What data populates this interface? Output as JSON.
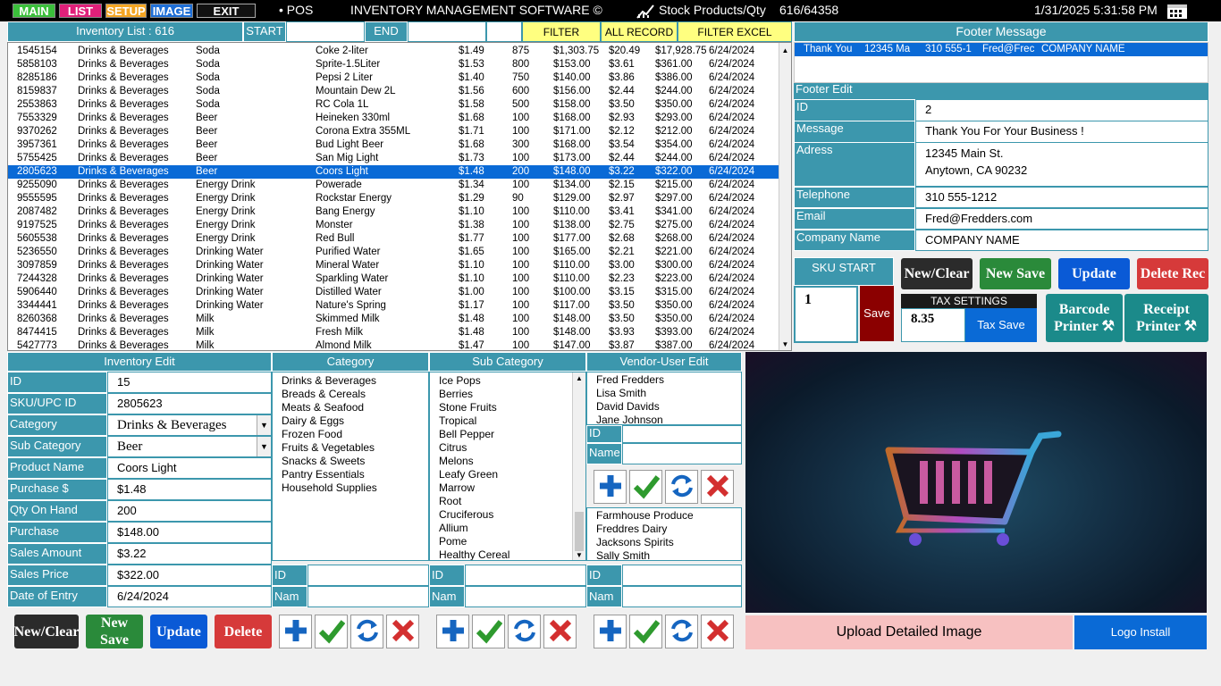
{
  "topbar": {
    "main": "MAIN",
    "list": "LIST",
    "setup": "SETUP",
    "image": "IMAGE",
    "exit": "EXIT",
    "pos": "• POS",
    "title": "INVENTORY MANAGEMENT SOFTWARE ©",
    "stock_label": "Stock Products/Qty",
    "stock_value": "616/64358",
    "datetime": "1/31/2025 5:31:58 PM"
  },
  "listbar": {
    "title": "Inventory List : 616",
    "start": "START",
    "end": "END",
    "filter": "FILTER",
    "all": "ALL RECORD",
    "excel": "FILTER EXCEL EXPORT"
  },
  "rows": [
    [
      "1545154",
      "Drinks & Beverages",
      "Soda",
      "Coke 2-liter",
      "$1.49",
      "875",
      "$1,303.75",
      "$20.49",
      "$17,928.75",
      "6/24/2024"
    ],
    [
      "5858103",
      "Drinks & Beverages",
      "Soda",
      "Sprite-1.5Liter",
      "$1.53",
      "800",
      "$153.00",
      "$3.61",
      "$361.00",
      "6/24/2024"
    ],
    [
      "8285186",
      "Drinks & Beverages",
      "Soda",
      "Pepsi 2 Liter",
      "$1.40",
      "750",
      "$140.00",
      "$3.86",
      "$386.00",
      "6/24/2024"
    ],
    [
      "8159837",
      "Drinks & Beverages",
      "Soda",
      "Mountain Dew 2L",
      "$1.56",
      "600",
      "$156.00",
      "$2.44",
      "$244.00",
      "6/24/2024"
    ],
    [
      "2553863",
      "Drinks & Beverages",
      "Soda",
      "RC Cola 1L",
      "$1.58",
      "500",
      "$158.00",
      "$3.50",
      "$350.00",
      "6/24/2024"
    ],
    [
      "7553329",
      "Drinks & Beverages",
      "Beer",
      "Heineken 330ml",
      "$1.68",
      "100",
      "$168.00",
      "$2.93",
      "$293.00",
      "6/24/2024"
    ],
    [
      "9370262",
      "Drinks & Beverages",
      "Beer",
      "Corona Extra 355ML",
      "$1.71",
      "100",
      "$171.00",
      "$2.12",
      "$212.00",
      "6/24/2024"
    ],
    [
      "3957361",
      "Drinks & Beverages",
      "Beer",
      "Bud Light Beer",
      "$1.68",
      "300",
      "$168.00",
      "$3.54",
      "$354.00",
      "6/24/2024"
    ],
    [
      "5755425",
      "Drinks & Beverages",
      "Beer",
      "San Mig Light",
      "$1.73",
      "100",
      "$173.00",
      "$2.44",
      "$244.00",
      "6/24/2024"
    ],
    [
      "2805623",
      "Drinks & Beverages",
      "Beer",
      "Coors Light",
      "$1.48",
      "200",
      "$148.00",
      "$3.22",
      "$322.00",
      "6/24/2024"
    ],
    [
      "9255090",
      "Drinks & Beverages",
      "Energy Drink",
      "Powerade",
      "$1.34",
      "100",
      "$134.00",
      "$2.15",
      "$215.00",
      "6/24/2024"
    ],
    [
      "9555595",
      "Drinks & Beverages",
      "Energy Drink",
      "Rockstar Energy",
      "$1.29",
      "90",
      "$129.00",
      "$2.97",
      "$297.00",
      "6/24/2024"
    ],
    [
      "2087482",
      "Drinks & Beverages",
      "Energy Drink",
      "Bang Energy",
      "$1.10",
      "100",
      "$110.00",
      "$3.41",
      "$341.00",
      "6/24/2024"
    ],
    [
      "9197525",
      "Drinks & Beverages",
      "Energy Drink",
      "Monster",
      "$1.38",
      "100",
      "$138.00",
      "$2.75",
      "$275.00",
      "6/24/2024"
    ],
    [
      "5605538",
      "Drinks & Beverages",
      "Energy Drink",
      "Red Bull",
      "$1.77",
      "100",
      "$177.00",
      "$2.68",
      "$268.00",
      "6/24/2024"
    ],
    [
      "5236550",
      "Drinks & Beverages",
      "Drinking Water",
      "Purified Water",
      "$1.65",
      "100",
      "$165.00",
      "$2.21",
      "$221.00",
      "6/24/2024"
    ],
    [
      "3097859",
      "Drinks & Beverages",
      "Drinking Water",
      "Mineral Water",
      "$1.10",
      "100",
      "$110.00",
      "$3.00",
      "$300.00",
      "6/24/2024"
    ],
    [
      "7244328",
      "Drinks & Beverages",
      "Drinking Water",
      "Sparkling Water",
      "$1.10",
      "100",
      "$110.00",
      "$2.23",
      "$223.00",
      "6/24/2024"
    ],
    [
      "5906440",
      "Drinks & Beverages",
      "Drinking Water",
      "Distilled Water",
      "$1.00",
      "100",
      "$100.00",
      "$3.15",
      "$315.00",
      "6/24/2024"
    ],
    [
      "3344441",
      "Drinks & Beverages",
      "Drinking Water",
      "Nature's Spring",
      "$1.17",
      "100",
      "$117.00",
      "$3.50",
      "$350.00",
      "6/24/2024"
    ],
    [
      "8260368",
      "Drinks & Beverages",
      "Milk",
      "Skimmed Milk",
      "$1.48",
      "100",
      "$148.00",
      "$3.50",
      "$350.00",
      "6/24/2024"
    ],
    [
      "8474415",
      "Drinks & Beverages",
      "Milk",
      "Fresh Milk",
      "$1.48",
      "100",
      "$148.00",
      "$3.93",
      "$393.00",
      "6/24/2024"
    ],
    [
      "5427773",
      "Drinks & Beverages",
      "Milk",
      "Almond Milk",
      "$1.47",
      "100",
      "$147.00",
      "$3.87",
      "$387.00",
      "6/24/2024"
    ]
  ],
  "footer": {
    "title": "Footer Message",
    "line": [
      "Thank You",
      "12345 Ma",
      "310 555-1",
      "Fred@Frec",
      "COMPANY NAME"
    ],
    "edit_title": "Footer Edit",
    "id_label": "ID",
    "id": "2",
    "msg_label": "Message",
    "msg": "Thank You For Your Business !",
    "addr_label": "Adress",
    "addr1": "12345 Main St.",
    "addr2": "Anytown, CA 90232",
    "tel_label": "Telephone",
    "tel": "310 555-1212",
    "email_label": "Email",
    "email": "Fred@Fredders.com",
    "company_label": "Company Name",
    "company": "COMPANY NAME"
  },
  "skuarea": {
    "title": "SKU START",
    "value": "1",
    "save": "Save",
    "tax_title": "TAX  SETTINGS",
    "tax": "8.35",
    "tax_save": "Tax Save",
    "new": "New/Clear",
    "newsave": "New Save",
    "update": "Update",
    "delete": "Delete Rec",
    "barcode": "Barcode Printer ⚒",
    "receipt": "Receipt Printer ⚒"
  },
  "edit": {
    "title": "Inventory Edit",
    "id_l": "ID",
    "id": "15",
    "sku_l": "SKU/UPC ID",
    "sku": "2805623",
    "cat_l": "Category",
    "cat": "Drinks & Beverages",
    "sub_l": "Sub Category",
    "sub": "Beer",
    "name_l": "Product Name",
    "name": "Coors Light",
    "pur_l": "Purchase $",
    "pur": "$1.48",
    "qty_l": "Qty On Hand",
    "qty": "200",
    "purt_l": "Purchase",
    "purt": "$148.00",
    "sales_l": "Sales Amount",
    "sales": "$3.22",
    "price_l": "Sales Price",
    "price": "$322.00",
    "date_l": "Date of Entry",
    "date": "6/24/2024",
    "new": "New/Clear",
    "newsave": "New Save",
    "update": "Update",
    "delete": "Delete"
  },
  "category": {
    "title": "Category",
    "items": [
      "Drinks & Beverages",
      "Breads & Cereals",
      "Meats & Seafood",
      "Dairy & Eggs",
      "Frozen Food",
      "Fruits & Vegetables",
      "Snacks & Sweets",
      "Pantry Essentials",
      "Household Supplies"
    ],
    "id_l": "ID",
    "nam_l": "Nam"
  },
  "subcategory": {
    "title": "Sub Category",
    "items": [
      "Ice Pops",
      "Berries",
      "Stone Fruits",
      "Tropical",
      "Bell Pepper",
      "Citrus",
      "Melons",
      "Leafy Green",
      "Marrow",
      "Root",
      "Cruciferous",
      "Allium",
      "Pome",
      "Healthy Cereal"
    ],
    "id_l": "ID",
    "nam_l": "Nam"
  },
  "vendor": {
    "title": "Vendor-User Edit",
    "users": [
      "Fred Fredders",
      "Lisa Smith",
      "David Davids",
      "Jane Johnson"
    ],
    "id_l": "ID",
    "name_l": "Name",
    "vendors": [
      "Farmhouse Produce",
      "Freddres Dairy",
      "Jacksons Spirits",
      "Sally Smith"
    ],
    "id2_l": "ID",
    "nam2_l": "Nam"
  },
  "image": {
    "upload": "Upload Detailed Image",
    "logo": "Logo Install"
  }
}
